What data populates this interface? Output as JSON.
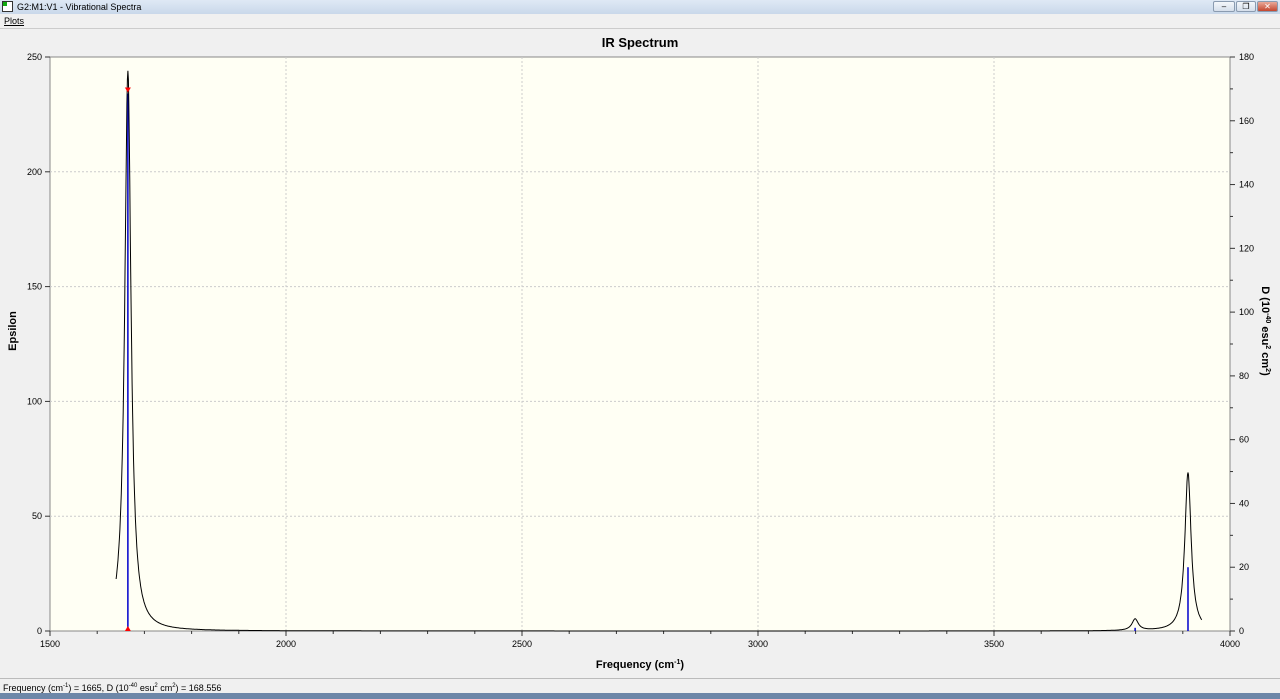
{
  "window": {
    "title": "G2:M1:V1 - Vibrational Spectra",
    "menu": [
      "Plots"
    ],
    "buttons": [
      "minimize",
      "restore",
      "close"
    ]
  },
  "status": {
    "html_parts": {
      "a": "Frequency (cm",
      "a_sup": "-1",
      "b": ") = 1665, D (10",
      "b_sup": "-40",
      "c": " esu",
      "c_sup": "2",
      "d": " cm",
      "d_sup": "2",
      "e": ") = 168.556"
    }
  },
  "chart_data": {
    "type": "line",
    "title": "IR Spectrum",
    "xlabel": "Frequency (cm-1)",
    "ylabel": "Epsilon",
    "y2label": "D (10-40 esu2 cm2)",
    "xlim": [
      1500,
      4000
    ],
    "ylim": [
      0,
      250
    ],
    "y2lim": [
      0,
      180
    ],
    "xticks": [
      1500,
      2000,
      2500,
      3000,
      3500,
      4000
    ],
    "yticks": [
      0,
      50,
      100,
      150,
      200,
      250
    ],
    "y2ticks": [
      0,
      20,
      40,
      60,
      80,
      100,
      120,
      140,
      160,
      180
    ],
    "grid": true,
    "background": "#fffff4",
    "curve_color": "#000000",
    "stick_color": "#0000cc",
    "marker_color": "#ff0000",
    "peaks": [
      {
        "frequency": 1665,
        "epsilon": 244,
        "D": 168.556
      },
      {
        "frequency": 3799,
        "epsilon": 5,
        "D": 1
      },
      {
        "frequency": 3911,
        "epsilon": 69,
        "D": 20
      }
    ],
    "selected_frequency": 1665
  }
}
